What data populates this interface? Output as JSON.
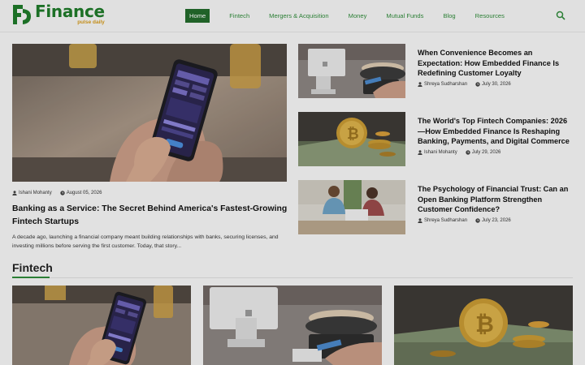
{
  "brand": {
    "name": "Finance",
    "tagline": "pulse daily",
    "color": "#1f7a2a",
    "accent": "#d49a1b"
  },
  "nav": {
    "items": [
      {
        "label": "Home",
        "active": true
      },
      {
        "label": "Fintech"
      },
      {
        "label": "Mergers & Acquisition"
      },
      {
        "label": "Money"
      },
      {
        "label": "Mutual Funds"
      },
      {
        "label": "Blog"
      },
      {
        "label": "Resources"
      }
    ]
  },
  "featured": {
    "author": "Ishani Mohanty",
    "date": "August 05, 2026",
    "title": "Banking as a Service: The Secret Behind America's Fastest-Growing Fintech Startups",
    "excerpt": "A decade ago, launching a financial company meant building relationships with banks, securing licenses, and investing millions before serving the first customer. Today, that story..."
  },
  "side_articles": [
    {
      "title": "When Convenience Becomes an Expectation: How Embedded Finance Is Redefining Customer Loyalty",
      "author": "Shreya Sudharshan",
      "date": "July 30, 2026"
    },
    {
      "title": "The World's Top Fintech Companies: 2026—How Embedded Finance Is Reshaping Banking, Payments, and Digital Commerce",
      "author": "Ishani Mohanty",
      "date": "July 29, 2026"
    },
    {
      "title": "The Psychology of Financial Trust: Can an Open Banking Platform Strengthen Customer Confidence?",
      "author": "Shreya Sudharshan",
      "date": "July 23, 2026"
    }
  ],
  "section": {
    "title": "Fintech"
  },
  "icons": {
    "search": "search-icon",
    "author": "user-icon",
    "date": "clock-icon"
  }
}
